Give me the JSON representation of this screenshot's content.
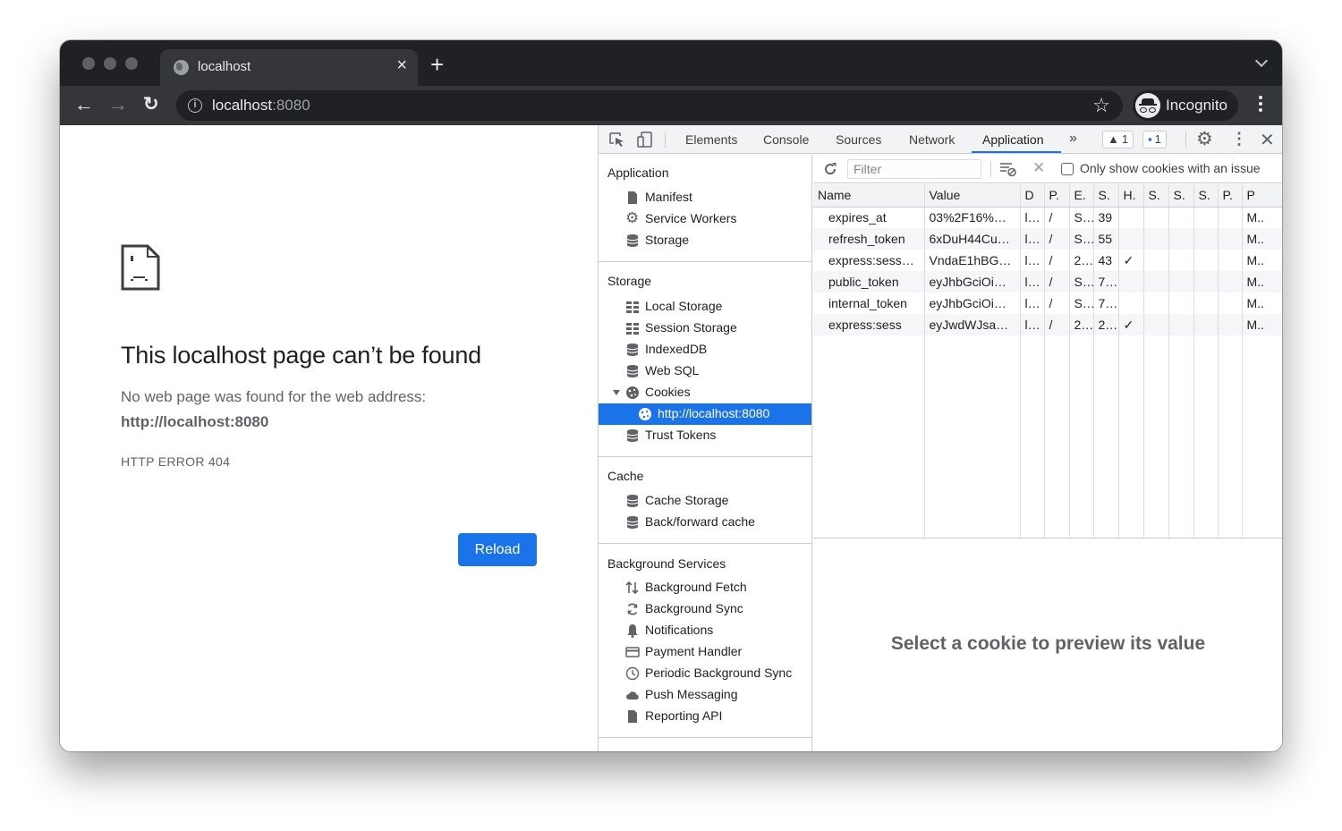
{
  "browser": {
    "tab": {
      "title": "localhost",
      "icon": "globe-icon"
    },
    "omnibox": {
      "host": "localhost",
      "port": ":8080"
    },
    "profile_label": "Incognito",
    "icons": {
      "back": "←",
      "forward": "→",
      "reload": "↻",
      "star": "☆",
      "close": "×",
      "new_tab": "+"
    }
  },
  "page": {
    "title": "This localhost page can’t be found",
    "description": "No web page was found for the web address:",
    "url": "http://localhost:8080",
    "error_code": "HTTP ERROR 404",
    "reload_label": "Reload"
  },
  "devtools": {
    "tabs": [
      "Elements",
      "Console",
      "Sources",
      "Network",
      "Application"
    ],
    "active_tab": "Application",
    "more_tabs": "»",
    "warnings_count": "1",
    "messages_count": "1",
    "sidebar": {
      "sections": [
        {
          "title": "Application",
          "items": [
            {
              "label": "Manifest",
              "icon": "document-icon"
            },
            {
              "label": "Service Workers",
              "icon": "gear-icon"
            },
            {
              "label": "Storage",
              "icon": "database-icon"
            }
          ]
        },
        {
          "title": "Storage",
          "items": [
            {
              "label": "Local Storage",
              "icon": "grid-icon"
            },
            {
              "label": "Session Storage",
              "icon": "grid-icon"
            },
            {
              "label": "IndexedDB",
              "icon": "database-icon"
            },
            {
              "label": "Web SQL",
              "icon": "database-icon"
            },
            {
              "label": "Cookies",
              "icon": "cookie-icon",
              "expanded": true
            },
            {
              "label": "http://localhost:8080",
              "icon": "cookie-icon",
              "selected": true
            },
            {
              "label": "Trust Tokens",
              "icon": "database-icon"
            }
          ]
        },
        {
          "title": "Cache",
          "items": [
            {
              "label": "Cache Storage",
              "icon": "database-icon"
            },
            {
              "label": "Back/forward cache",
              "icon": "database-icon"
            }
          ]
        },
        {
          "title": "Background Services",
          "items": [
            {
              "label": "Background Fetch",
              "icon": "arrows-up-down-icon"
            },
            {
              "label": "Background Sync",
              "icon": "sync-icon"
            },
            {
              "label": "Notifications",
              "icon": "bell-icon"
            },
            {
              "label": "Payment Handler",
              "icon": "card-icon"
            },
            {
              "label": "Periodic Background Sync",
              "icon": "clock-icon"
            },
            {
              "label": "Push Messaging",
              "icon": "cloud-icon"
            },
            {
              "label": "Reporting API",
              "icon": "document-icon"
            }
          ]
        }
      ]
    },
    "cookies": {
      "filter_placeholder": "Filter",
      "only_issues_label": "Only show cookies with an issue",
      "only_issues_checked": false,
      "columns": [
        "Name",
        "Value",
        "D",
        "P.",
        "E.",
        "S.",
        "H.",
        "S.",
        "S.",
        "S.",
        "P.",
        "P"
      ],
      "rows": [
        [
          "expires_at",
          "03%2F16%…",
          "l…",
          "/",
          "S…",
          "39",
          "",
          "",
          "",
          "",
          "",
          "M.."
        ],
        [
          "refresh_token",
          "6xDuH44Cu…",
          "l…",
          "/",
          "S…",
          "55",
          "",
          "",
          "",
          "",
          "",
          "M.."
        ],
        [
          "express:sess…",
          "VndaE1hBG…",
          "l…",
          "/",
          "2…",
          "43",
          "✓",
          "",
          "",
          "",
          "",
          "M.."
        ],
        [
          "public_token",
          "eyJhbGciOi…",
          "l…",
          "/",
          "S…",
          "7…",
          "",
          "",
          "",
          "",
          "",
          "M.."
        ],
        [
          "internal_token",
          "eyJhbGciOi…",
          "l…",
          "/",
          "S…",
          "7…",
          "",
          "",
          "",
          "",
          "",
          "M.."
        ],
        [
          "express:sess",
          "eyJwdWJsa…",
          "l…",
          "/",
          "2…",
          "2…",
          "✓",
          "",
          "",
          "",
          "",
          "M.."
        ]
      ],
      "preview_text": "Select a cookie to preview its value"
    }
  }
}
